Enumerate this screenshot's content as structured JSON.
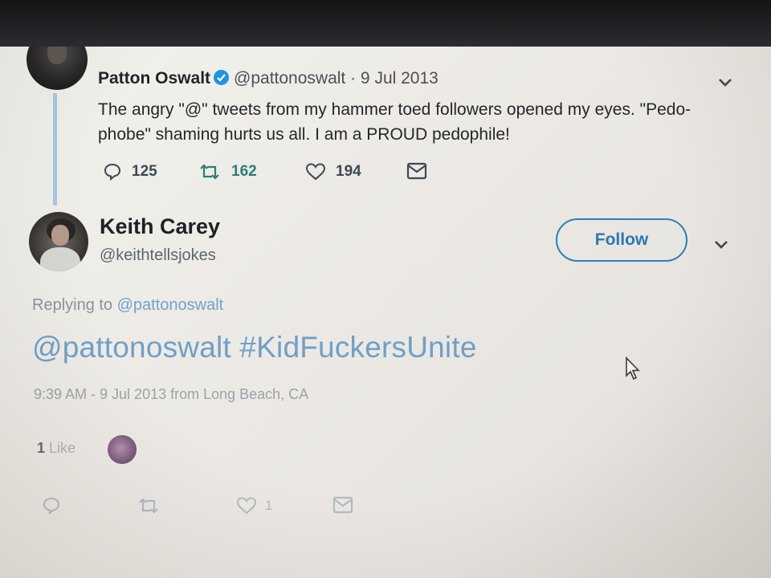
{
  "original_tweet": {
    "author_name": "Patton Oswalt",
    "handle": "@pattonoswalt",
    "date": "· 9 Jul 2013",
    "text": "The angry \"@\" tweets from my hammer toed followers opened my eyes. \"Pedo-phobe\" shaming hurts us all. I am a PROUD pedophile!",
    "replies": "125",
    "retweets": "162",
    "likes": "194",
    "icons": {
      "verified": "verified-badge-icon",
      "menu": "chevron-down-icon",
      "reply": "reply-icon",
      "retweet": "retweet-icon",
      "like": "heart-icon",
      "dm": "envelope-icon"
    }
  },
  "reply_tweet": {
    "author_name": "Keith Carey",
    "handle": "@keithtellsjokes",
    "follow_label": "Follow",
    "replying_prefix": "Replying to",
    "replying_to": "@pattonoswalt",
    "text": "@pattonoswalt #KidFuckersUnite",
    "meta": "9:39 AM - 9 Jul 2013 from Long Beach, CA",
    "like_count": "1",
    "like_label": "Like",
    "action_like_count": "1",
    "icons": {
      "menu": "chevron-down-icon",
      "reply": "reply-icon",
      "retweet": "retweet-icon",
      "like": "heart-icon",
      "dm": "envelope-icon"
    }
  },
  "colors": {
    "accent": "#1b95e0",
    "link": "#6f9fc8",
    "follow_border": "#2f7fb9",
    "thread_line": "#a6c7e3"
  }
}
